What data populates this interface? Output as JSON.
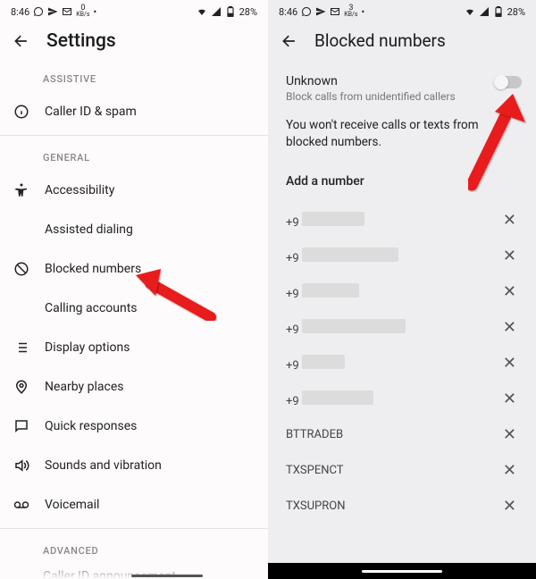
{
  "status": {
    "time": "8:46",
    "kb_rate": "0",
    "kb_rate2": "3",
    "kb_unit": "KB/s",
    "battery": "28%"
  },
  "left": {
    "title": "Settings",
    "sec_assistive": "ASSISTIVE",
    "caller_id_spam": "Caller ID & spam",
    "sec_general": "GENERAL",
    "accessibility": "Accessibility",
    "assisted_dialing": "Assisted dialing",
    "blocked_numbers": "Blocked numbers",
    "calling_accounts": "Calling accounts",
    "display_options": "Display options",
    "nearby_places": "Nearby places",
    "quick_responses": "Quick responses",
    "sounds_vibration": "Sounds and vibration",
    "voicemail": "Voicemail",
    "sec_advanced": "ADVANCED",
    "caller_id_ann": "Caller ID announcement"
  },
  "right": {
    "title": "Blocked numbers",
    "unknown_title": "Unknown",
    "unknown_sub": "Block calls from unidentified callers",
    "info": "You won't receive calls or texts from blocked numbers.",
    "add": "Add a number",
    "items": [
      {
        "prefix": "+9",
        "blurred": true,
        "bw": 70
      },
      {
        "prefix": "+9",
        "blurred": true,
        "bw": 108
      },
      {
        "prefix": "+9",
        "blurred": true,
        "bw": 64
      },
      {
        "prefix": "+9",
        "blurred": true,
        "bw": 116
      },
      {
        "prefix": "+9",
        "blurred": true,
        "bw": 48
      },
      {
        "prefix": "+9",
        "blurred": true,
        "bw": 80
      },
      {
        "label": "BTTRADEB",
        "blurred": false
      },
      {
        "label": "TXSPENCT",
        "blurred": false
      },
      {
        "label": "TXSUPRON",
        "blurred": false
      }
    ]
  }
}
